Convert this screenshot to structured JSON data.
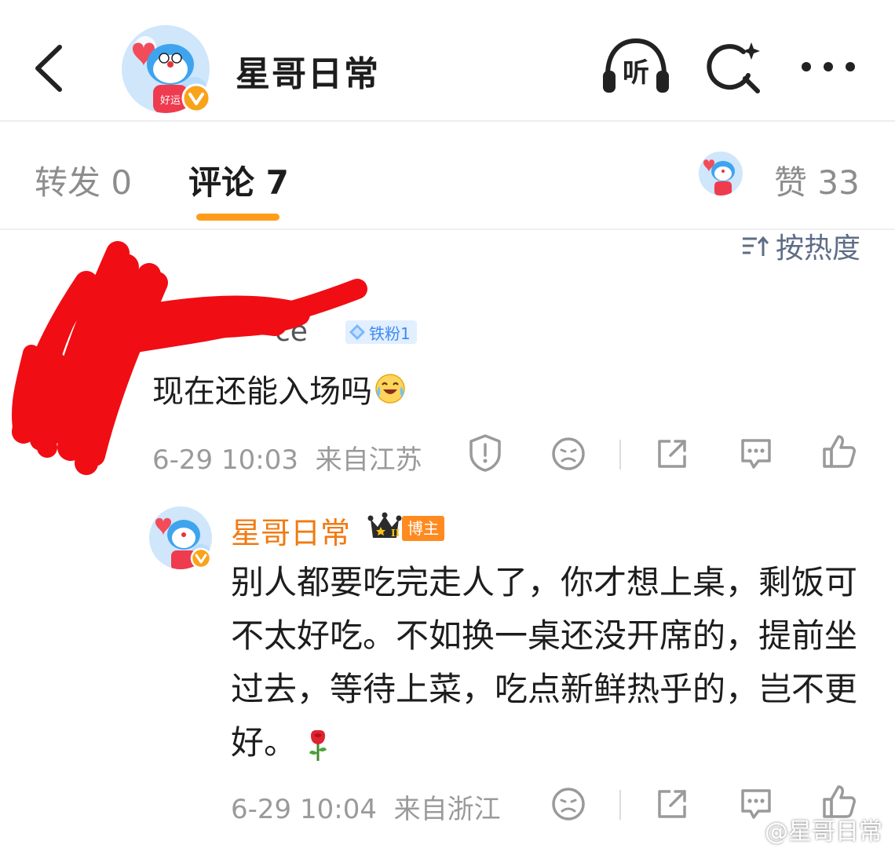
{
  "header": {
    "back_icon": "chevron-left-icon",
    "title": "星哥日常",
    "listen_label": "听",
    "search_icon": "search-sparkle-icon",
    "more_icon": "more-dots-icon"
  },
  "tabs": {
    "repost": "转发 0",
    "comment": "评论 7",
    "likes": "赞 33",
    "active_color": "#ff9d1a"
  },
  "sort": {
    "label": "按热度"
  },
  "comments": [
    {
      "name_visible": "ce",
      "fan_badge": "铁粉1",
      "text": "现在还能入场吗",
      "emoji": "laughing-crying-emoji",
      "time": "6-29 10:03",
      "location": "来自江苏",
      "actions": [
        "report-icon",
        "dislike-icon",
        "share-icon",
        "comment-icon",
        "like-icon"
      ],
      "replies": [
        {
          "name": "星哥日常",
          "name_color": "#f07a12",
          "crown_level": "II",
          "badge": "博主",
          "text": "别人都要吃完走人了，你才想上桌，剩饭可不太好吃。不如换一桌还没开席的，提前坐过去，等待上菜，吃点新鲜热乎的，岂不更好。",
          "emoji": "rose-emoji",
          "time": "6-29 10:04",
          "location": "来自浙江",
          "actions": [
            "dislike-icon",
            "share-icon",
            "comment-icon",
            "like-icon"
          ]
        }
      ]
    }
  ],
  "watermark": "@星哥日常"
}
